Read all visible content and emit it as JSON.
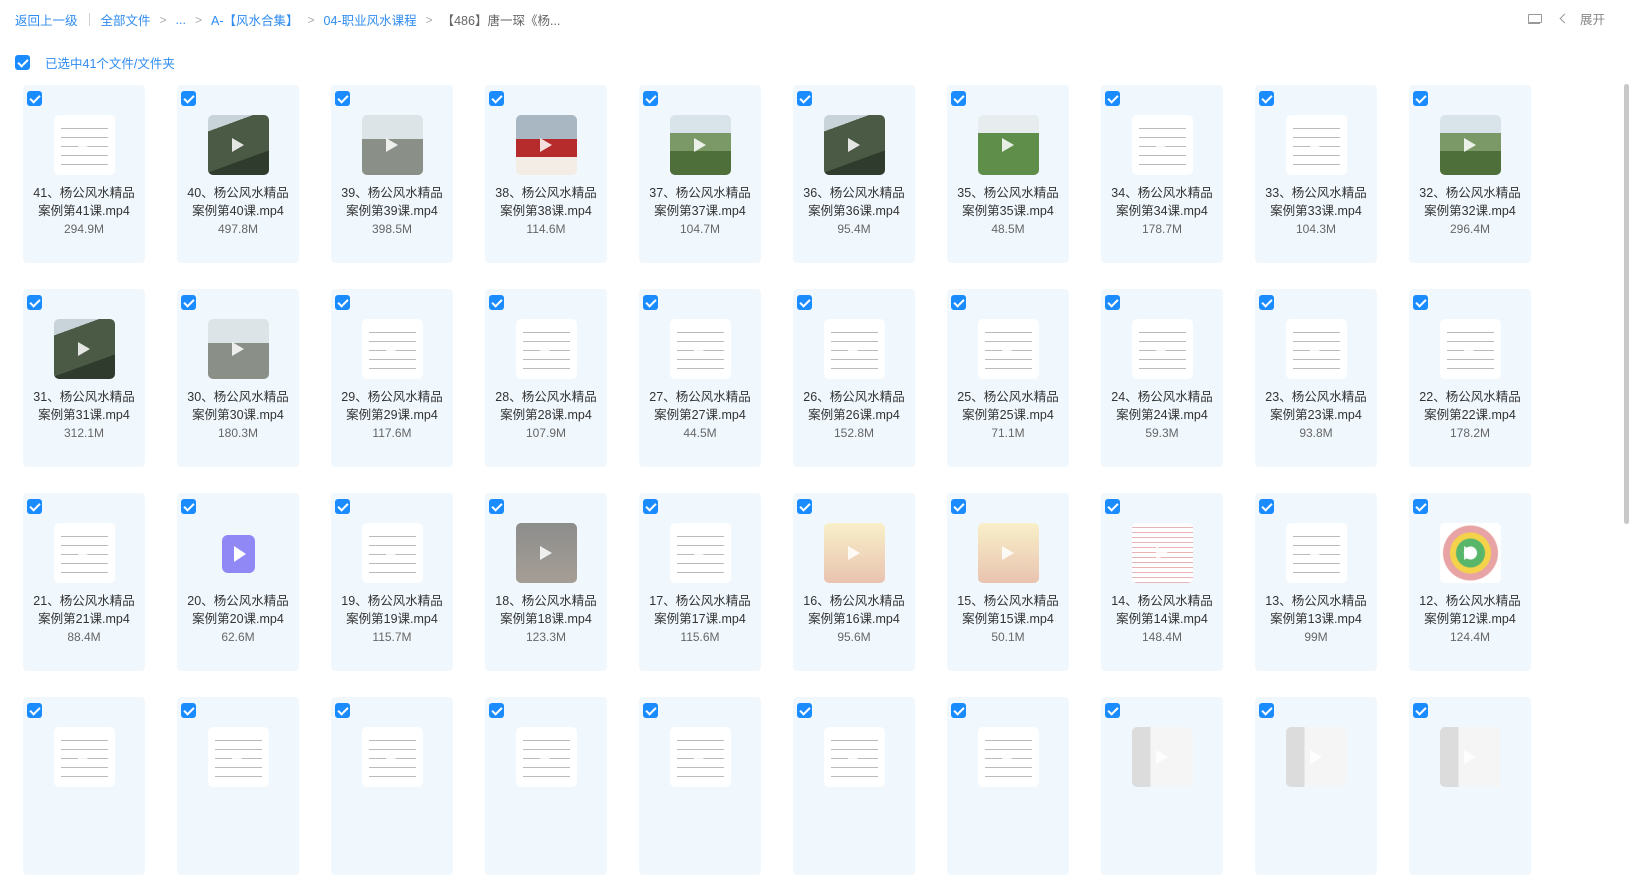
{
  "breadcrumb": {
    "back": "返回上一级",
    "all_files": "全部文件",
    "ellipsis": "...",
    "level1": "A-【风水合集】",
    "level2": "04-职业风水课程",
    "current": "【486】唐一琛《杨..."
  },
  "toolbar": {
    "expand_label": "展开"
  },
  "selection": {
    "label": "已选中41个文件/文件夹"
  },
  "colors": {
    "accent": "#2f8cf0",
    "checkbox": "#1a8cff",
    "card_bg": "#f0f8fe"
  },
  "files": [
    {
      "line1": "41、杨公风水精品",
      "line2": "案例第41课.mp4",
      "size": "294.9M",
      "thumb": "doc"
    },
    {
      "line1": "40、杨公风水精品",
      "line2": "案例第40课.mp4",
      "size": "497.8M",
      "thumb": "photo-dark"
    },
    {
      "line1": "39、杨公风水精品",
      "line2": "案例第39课.mp4",
      "size": "398.5M",
      "thumb": "photo-grey"
    },
    {
      "line1": "38、杨公风水精品",
      "line2": "案例第38课.mp4",
      "size": "114.6M",
      "thumb": "photo-red"
    },
    {
      "line1": "37、杨公风水精品",
      "line2": "案例第37课.mp4",
      "size": "104.7M",
      "thumb": "photo-green"
    },
    {
      "line1": "36、杨公风水精品",
      "line2": "案例第36课.mp4",
      "size": "95.4M",
      "thumb": "photo-dark"
    },
    {
      "line1": "35、杨公风水精品",
      "line2": "案例第35课.mp4",
      "size": "48.5M",
      "thumb": "photo-rice"
    },
    {
      "line1": "34、杨公风水精品",
      "line2": "案例第34课.mp4",
      "size": "178.7M",
      "thumb": "doc"
    },
    {
      "line1": "33、杨公风水精品",
      "line2": "案例第33课.mp4",
      "size": "104.3M",
      "thumb": "doc"
    },
    {
      "line1": "32、杨公风水精品",
      "line2": "案例第32课.mp4",
      "size": "296.4M",
      "thumb": "photo-green"
    },
    {
      "line1": "31、杨公风水精品",
      "line2": "案例第31课.mp4",
      "size": "312.1M",
      "thumb": "photo-dark"
    },
    {
      "line1": "30、杨公风水精品",
      "line2": "案例第30课.mp4",
      "size": "180.3M",
      "thumb": "photo-grey"
    },
    {
      "line1": "29、杨公风水精品",
      "line2": "案例第29课.mp4",
      "size": "117.6M",
      "thumb": "doc"
    },
    {
      "line1": "28、杨公风水精品",
      "line2": "案例第28课.mp4",
      "size": "107.9M",
      "thumb": "doc"
    },
    {
      "line1": "27、杨公风水精品",
      "line2": "案例第27课.mp4",
      "size": "44.5M",
      "thumb": "doc"
    },
    {
      "line1": "26、杨公风水精品",
      "line2": "案例第26课.mp4",
      "size": "152.8M",
      "thumb": "doc"
    },
    {
      "line1": "25、杨公风水精品",
      "line2": "案例第25课.mp4",
      "size": "71.1M",
      "thumb": "doc"
    },
    {
      "line1": "24、杨公风水精品",
      "line2": "案例第24课.mp4",
      "size": "59.3M",
      "thumb": "doc"
    },
    {
      "line1": "23、杨公风水精品",
      "line2": "案例第23课.mp4",
      "size": "93.8M",
      "thumb": "doc"
    },
    {
      "line1": "22、杨公风水精品",
      "line2": "案例第22课.mp4",
      "size": "178.2M",
      "thumb": "doc"
    },
    {
      "line1": "21、杨公风水精品",
      "line2": "案例第21课.mp4",
      "size": "88.4M",
      "thumb": "doc"
    },
    {
      "line1": "20、杨公风水精品",
      "line2": "案例第20课.mp4",
      "size": "62.6M",
      "thumb": "video-file"
    },
    {
      "line1": "19、杨公风水精品",
      "line2": "案例第19课.mp4",
      "size": "115.7M",
      "thumb": "doc"
    },
    {
      "line1": "18、杨公风水精品",
      "line2": "案例第18课.mp4",
      "size": "123.3M",
      "thumb": "hand2"
    },
    {
      "line1": "17、杨公风水精品",
      "line2": "案例第17课.mp4",
      "size": "115.6M",
      "thumb": "doc"
    },
    {
      "line1": "16、杨公风水精品",
      "line2": "案例第16课.mp4",
      "size": "95.6M",
      "thumb": "hand"
    },
    {
      "line1": "15、杨公风水精品",
      "line2": "案例第15课.mp4",
      "size": "50.1M",
      "thumb": "hand"
    },
    {
      "line1": "14、杨公风水精品",
      "line2": "案例第14课.mp4",
      "size": "148.4M",
      "thumb": "table"
    },
    {
      "line1": "13、杨公风水精品",
      "line2": "案例第13课.mp4",
      "size": "99M",
      "thumb": "doc"
    },
    {
      "line1": "12、杨公风水精品",
      "line2": "案例第12课.mp4",
      "size": "124.4M",
      "thumb": "wheel"
    },
    {
      "line1": "",
      "line2": "",
      "size": "",
      "thumb": "doc"
    },
    {
      "line1": "",
      "line2": "",
      "size": "",
      "thumb": "doc"
    },
    {
      "line1": "",
      "line2": "",
      "size": "",
      "thumb": "doc"
    },
    {
      "line1": "",
      "line2": "",
      "size": "",
      "thumb": "doc"
    },
    {
      "line1": "",
      "line2": "",
      "size": "",
      "thumb": "doc"
    },
    {
      "line1": "",
      "line2": "",
      "size": "",
      "thumb": "doc"
    },
    {
      "line1": "",
      "line2": "",
      "size": "",
      "thumb": "doc"
    },
    {
      "line1": "",
      "line2": "",
      "size": "",
      "thumb": "person"
    },
    {
      "line1": "",
      "line2": "",
      "size": "",
      "thumb": "person"
    },
    {
      "line1": "",
      "line2": "",
      "size": "",
      "thumb": "person"
    }
  ]
}
